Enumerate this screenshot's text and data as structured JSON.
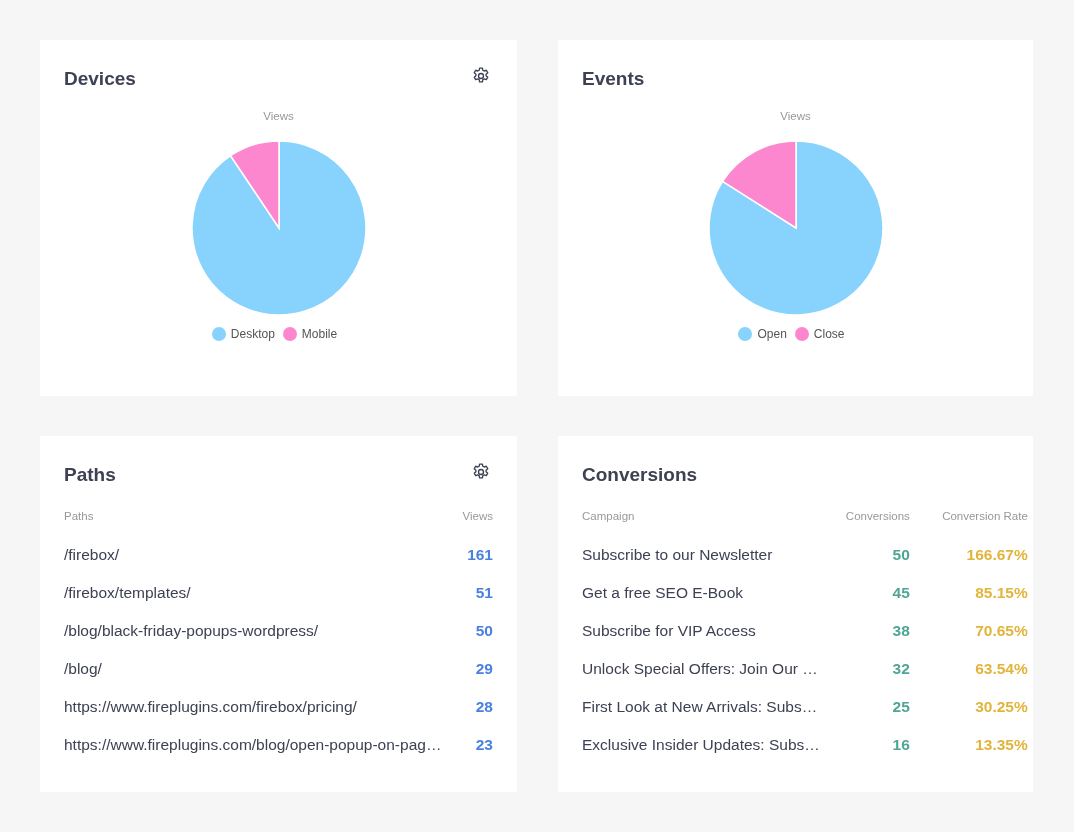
{
  "cards": [
    {
      "kind": "pie",
      "title": "Devices",
      "settings": true,
      "chart_title": "Views",
      "legend": [
        {
          "label": "Desktop",
          "color": "#87d3fd"
        },
        {
          "label": "Mobile",
          "color": "#fd87cf"
        }
      ]
    },
    {
      "kind": "pie",
      "title": "Events",
      "settings": false,
      "chart_title": "Views",
      "legend": [
        {
          "label": "Open",
          "color": "#87d3fd"
        },
        {
          "label": "Close",
          "color": "#fd87cf"
        }
      ]
    },
    {
      "kind": "table",
      "title": "Paths",
      "settings": true,
      "columns": [
        {
          "label": "Paths",
          "kind": "text"
        },
        {
          "label": "Views",
          "kind": "blue"
        }
      ],
      "rows": [
        [
          "/firebox/",
          "161"
        ],
        [
          "/firebox/templates/",
          "51"
        ],
        [
          "/blog/black-friday-popups-wordpress/",
          "50"
        ],
        [
          "/blog/",
          "29"
        ],
        [
          "https://www.fireplugins.com/firebox/pricing/",
          "28"
        ],
        [
          "https://www.fireplugins.com/blog/open-popup-on-pag…",
          "23"
        ]
      ]
    },
    {
      "kind": "table",
      "title": "Conversions",
      "settings": false,
      "columns": [
        {
          "label": "Campaign",
          "kind": "text"
        },
        {
          "label": "Conversions",
          "kind": "teal"
        },
        {
          "label": "Conversion Rate",
          "kind": "gold"
        }
      ],
      "rows": [
        [
          "Subscribe to our Newsletter",
          "50",
          "166.67%"
        ],
        [
          "Get a free SEO E-Book",
          "45",
          "85.15%"
        ],
        [
          "Subscribe for VIP Access",
          "38",
          "70.65%"
        ],
        [
          "Unlock Special Offers: Join Our …",
          "32",
          "63.54%"
        ],
        [
          "First Look at New Arrivals: Subs…",
          "25",
          "30.25%"
        ],
        [
          "Exclusive Insider Updates: Subs…",
          "16",
          "13.35%"
        ]
      ]
    }
  ]
}
